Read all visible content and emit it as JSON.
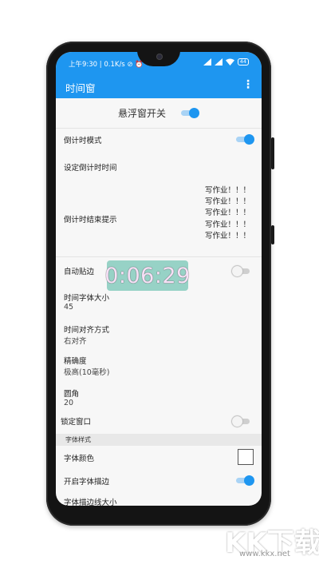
{
  "status_bar": {
    "time_speed": "上午9:30 | 0.1K/s",
    "battery": "44"
  },
  "toolbar": {
    "title": "时间窗"
  },
  "floating_switch": {
    "label": "悬浮窗开关",
    "on": true
  },
  "settings": {
    "countdown_mode": {
      "label": "倒计时模式",
      "on": true
    },
    "set_countdown_time": {
      "label": "设定倒计时时间"
    },
    "countdown_end_hint": {
      "label": "倒计时结束提示",
      "lines": [
        "写作业！！！",
        "写作业！！！",
        "写作业！！！",
        "写作业！！！",
        "写作业！！！"
      ]
    },
    "auto_snap": {
      "label": "自动贴边",
      "on": false
    },
    "time_font_size": {
      "label": "时间字体大小",
      "value": "45"
    },
    "time_align": {
      "label": "时间对齐方式",
      "value": "右对齐"
    },
    "precision": {
      "label": "精确度",
      "value": "极高(10毫秒)"
    },
    "corner_radius": {
      "label": "圆角",
      "value": "20"
    },
    "lock_window": {
      "label": "锁定窗口",
      "on": false
    },
    "font_style_section": "字体样式",
    "font_color": {
      "label": "字体颜色",
      "value_color": "#ffffff"
    },
    "font_stroke": {
      "label": "开启字体描边",
      "on": true
    },
    "stroke_size": {
      "label": "字体描边线大小"
    }
  },
  "floating_timer": {
    "text": "0:06:29",
    "bg_color": "#8fcfc2",
    "text_color": "#f6dff6"
  },
  "watermark": {
    "text": "KK下载",
    "sub": "www.kkx.net"
  },
  "colors": {
    "accent": "#1e96f0",
    "background": "#f7f7f7"
  }
}
